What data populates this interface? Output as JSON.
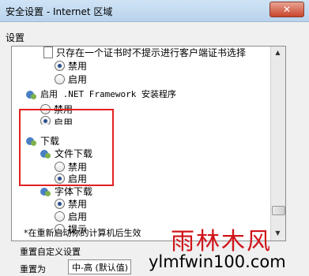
{
  "window": {
    "title": "安全设置 - Internet 区域",
    "close_glyph": "✕"
  },
  "settings": {
    "group_label": "设置",
    "items": {
      "cert_prompt_label": "只存在一个证书时不提示进行客户端证书选择",
      "cert_disable": "禁用",
      "cert_enable": "启用",
      "netfx_label": "启用 .NET Framework 安装程序",
      "netfx_disable": "禁用",
      "netfx_enable": "启用",
      "download_label": "下载",
      "file_download_label": "文件下载",
      "file_download_disable": "禁用",
      "file_download_enable": "启用",
      "font_download_label": "字体下载",
      "font_download_disable": "禁用",
      "font_download_enable": "启用",
      "font_download_prompt": "提示"
    },
    "note": "*在重新启动你的计算机后生效"
  },
  "reset": {
    "group_label": "重置自定义设置",
    "label": "重置为",
    "selected": "中-高 (默认值)"
  },
  "watermark": {
    "zh": "雨林木风",
    "url": "ylmfwin100.com"
  },
  "colors": {
    "highlight": "#e22020",
    "radio_dot": "#2b4d8c",
    "watermark_red": "#d0141a"
  },
  "icons": {
    "document": "document-icon",
    "settings": "settings-gear-icon"
  }
}
